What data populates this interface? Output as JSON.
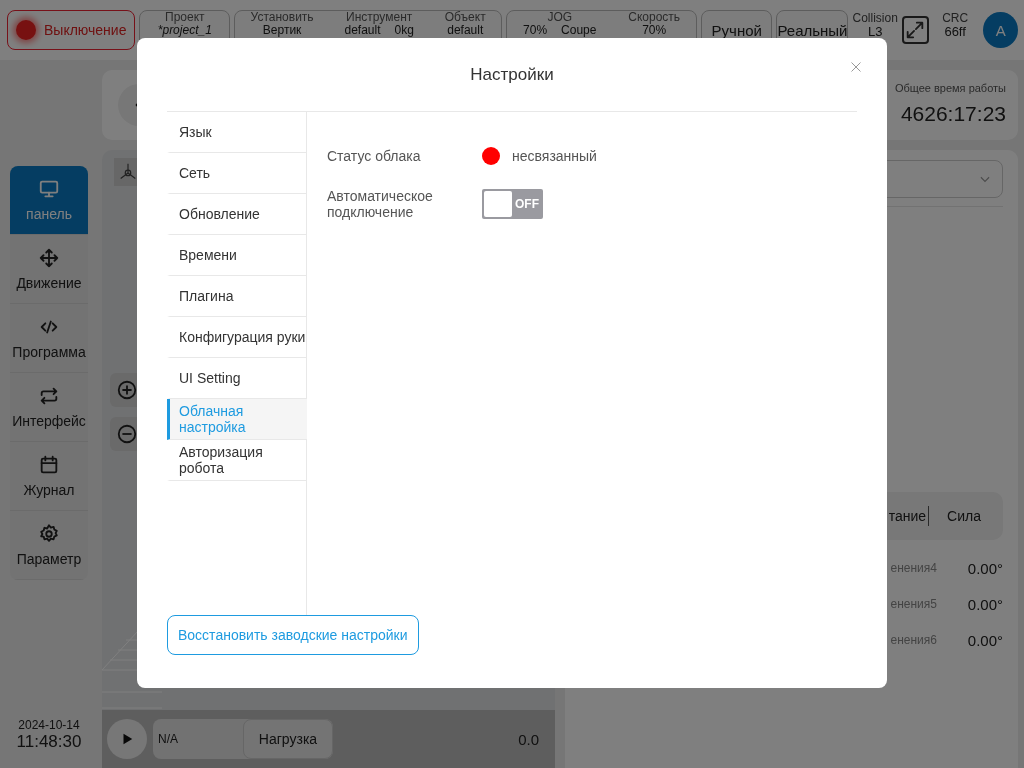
{
  "top_bar": {
    "power_button": {
      "label": "Выключение"
    },
    "project": {
      "label": "Проект",
      "values": [
        "*project_1"
      ]
    },
    "setup_group": [
      {
        "label": "Установить",
        "values": [
          "Вертик"
        ]
      },
      {
        "label": "Инструмент",
        "values": [
          "default",
          "0kg"
        ]
      },
      {
        "label": "Объект",
        "values": [
          "default"
        ]
      }
    ],
    "motion_group": [
      {
        "label": "JOG",
        "values": [
          "70%",
          "Coupe"
        ]
      },
      {
        "label": "Скорость",
        "values": [
          "70%"
        ]
      }
    ],
    "mode_buttons": [
      "Ручной",
      "Реальный"
    ],
    "collision": {
      "label": "Collision",
      "value": "L3"
    },
    "crc": {
      "label": "CRC",
      "value": "66ff"
    },
    "avatar": "A"
  },
  "nav": [
    {
      "label": "панель",
      "kind": "monitor",
      "selected": true
    },
    {
      "label": "Движение",
      "kind": "move",
      "selected": false
    },
    {
      "label": "Программа",
      "kind": "code",
      "selected": false
    },
    {
      "label": "Интерфейс",
      "kind": "swap",
      "selected": false
    },
    {
      "label": "Журнал",
      "kind": "calendar",
      "selected": false
    },
    {
      "label": "Параметр",
      "kind": "gear",
      "selected": false
    }
  ],
  "datetime": {
    "date": "2024-10-14",
    "time": "11:48:30"
  },
  "view": {
    "payload_value": "N/A",
    "payload_button": "Нагрузка",
    "speed": "0.0"
  },
  "right_panel": {
    "runtime": {
      "label": "Общее время работы",
      "value": "4626:17:23"
    },
    "tabs": [
      "тание",
      "Сила"
    ],
    "joints": [
      {
        "label": "енения4",
        "value": "0.00°"
      },
      {
        "label": "енения5",
        "value": "0.00°"
      },
      {
        "label": "енения6",
        "value": "0.00°"
      }
    ]
  },
  "dialog": {
    "title": "Настройки",
    "menu": [
      {
        "label": "Язык",
        "selected": false
      },
      {
        "label": "Сеть",
        "selected": false
      },
      {
        "label": "Обновление",
        "selected": false
      },
      {
        "label": "Времени",
        "selected": false
      },
      {
        "label": "Плагина",
        "selected": false
      },
      {
        "label": "Конфигурация руки",
        "selected": false
      },
      {
        "label": "UI Setting",
        "selected": false
      },
      {
        "label": "Облачная настройка",
        "selected": true
      },
      {
        "label": "Авторизация робота",
        "selected": false
      }
    ],
    "cloud_status": {
      "label": "Статус облака",
      "connected": false,
      "status": "несвязанный"
    },
    "auto_connect": {
      "label": "Автоматическое подключение",
      "on": false,
      "text": "OFF"
    },
    "reset_button": "Восстановить заводские настройки"
  }
}
